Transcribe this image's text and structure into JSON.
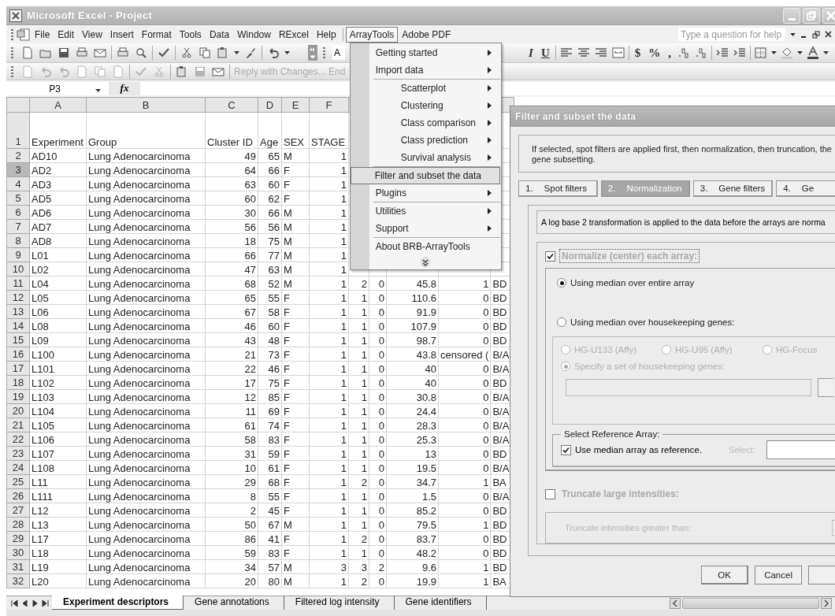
{
  "window": {
    "title": "Microsoft Excel - Project"
  },
  "menu_bar": {
    "items": [
      {
        "label": "File",
        "selected": false
      },
      {
        "label": "Edit",
        "selected": false
      },
      {
        "label": "View",
        "selected": false
      },
      {
        "label": "Insert",
        "selected": false
      },
      {
        "label": "Format",
        "selected": false
      },
      {
        "label": "Tools",
        "selected": false
      },
      {
        "label": "Data",
        "selected": false
      },
      {
        "label": "Window",
        "selected": false
      },
      {
        "label": "RExcel",
        "selected": false
      },
      {
        "label": "Help",
        "selected": false
      },
      {
        "label": "ArrayTools",
        "selected": true
      },
      {
        "label": "Adobe PDF",
        "selected": false
      }
    ],
    "help_box": {
      "placeholder": "Type a question for help"
    }
  },
  "dropdown": {
    "items": [
      {
        "label": "Getting started",
        "submenu": true,
        "indent": false,
        "group_start": false,
        "selected": false
      },
      {
        "label": "Import data",
        "submenu": true,
        "indent": false,
        "group_start": false,
        "selected": false
      },
      {
        "label": "Scatterplot",
        "submenu": true,
        "indent": true,
        "group_start": true,
        "selected": false
      },
      {
        "label": "Clustering",
        "submenu": true,
        "indent": true,
        "group_start": false,
        "selected": false
      },
      {
        "label": "Class comparison",
        "submenu": true,
        "indent": true,
        "group_start": false,
        "selected": false
      },
      {
        "label": "Class prediction",
        "submenu": true,
        "indent": true,
        "group_start": false,
        "selected": false
      },
      {
        "label": "Survival analysis",
        "submenu": true,
        "indent": true,
        "group_start": false,
        "selected": false
      },
      {
        "label": "Filter and subset the data",
        "submenu": false,
        "indent": false,
        "group_start": true,
        "selected": true
      },
      {
        "label": "Plugins",
        "submenu": true,
        "indent": false,
        "group_start": false,
        "selected": false
      },
      {
        "label": "Utilities",
        "submenu": true,
        "indent": false,
        "group_start": true,
        "selected": false
      },
      {
        "label": "Support",
        "submenu": true,
        "indent": false,
        "group_start": false,
        "selected": false
      },
      {
        "label": "About BRB-ArrayTools",
        "submenu": false,
        "indent": false,
        "group_start": true,
        "selected": false
      }
    ]
  },
  "standard_toolbar": {
    "font_box": "A"
  },
  "formatting_toolbar": {
    "buttons": [
      {
        "label": "I",
        "kind": "italic"
      },
      {
        "label": "U",
        "kind": "underline"
      },
      {
        "label": "$",
        "kind": "plain"
      },
      {
        "label": "%",
        "kind": "plain"
      },
      {
        "label": ",",
        "kind": "plain"
      }
    ]
  },
  "reviewing_toolbar": {
    "reply_text": "Reply with Changes... End"
  },
  "formula_bar": {
    "name_box": "P3",
    "fx": "fx"
  },
  "sheet": {
    "columns": [
      "A",
      "B",
      "C",
      "D",
      "E",
      "F"
    ],
    "rows": [
      {
        "number": "1",
        "selected": false,
        "cells": [
          "Experiment",
          "Group",
          "Cluster ID",
          "Age",
          "SEX",
          "STAGE"
        ]
      },
      {
        "number": "2",
        "selected": false,
        "cells": [
          "AD10",
          "Lung Adenocarcinoma",
          "49",
          "65",
          "M",
          "1"
        ]
      },
      {
        "number": "3",
        "selected": true,
        "cells": [
          "AD2",
          "Lung Adenocarcinoma",
          "64",
          "66",
          "F",
          "1"
        ]
      },
      {
        "number": "4",
        "selected": false,
        "cells": [
          "AD3",
          "Lung Adenocarcinoma",
          "63",
          "60",
          "F",
          "1"
        ]
      },
      {
        "number": "5",
        "selected": false,
        "cells": [
          "AD5",
          "Lung Adenocarcinoma",
          "60",
          "62",
          "F",
          "1"
        ]
      },
      {
        "number": "6",
        "selected": false,
        "cells": [
          "AD6",
          "Lung Adenocarcinoma",
          "30",
          "66",
          "M",
          "1"
        ]
      },
      {
        "number": "7",
        "selected": false,
        "cells": [
          "AD7",
          "Lung Adenocarcinoma",
          "56",
          "56",
          "M",
          "1"
        ]
      },
      {
        "number": "8",
        "selected": false,
        "cells": [
          "AD8",
          "Lung Adenocarcinoma",
          "18",
          "75",
          "M",
          "1"
        ]
      },
      {
        "number": "9",
        "selected": false,
        "cells": [
          "L01",
          "Lung Adenocarcinoma",
          "66",
          "77",
          "M",
          "1"
        ]
      },
      {
        "number": "10",
        "selected": false,
        "cells": [
          "L02",
          "Lung Adenocarcinoma",
          "47",
          "63",
          "M",
          "1"
        ]
      },
      {
        "number": "11",
        "selected": false,
        "cells": [
          "L04",
          "Lung Adenocarcinoma",
          "68",
          "52",
          "M",
          "1",
          "2",
          "0",
          "45.8",
          "1",
          "BD"
        ]
      },
      {
        "number": "12",
        "selected": false,
        "cells": [
          "L05",
          "Lung Adenocarcinoma",
          "65",
          "55",
          "F",
          "1",
          "1",
          "0",
          "110.6",
          "0",
          "BD"
        ]
      },
      {
        "number": "13",
        "selected": false,
        "cells": [
          "L06",
          "Lung Adenocarcinoma",
          "67",
          "58",
          "F",
          "1",
          "1",
          "0",
          "91.9",
          "0",
          "BD"
        ]
      },
      {
        "number": "14",
        "selected": false,
        "cells": [
          "L08",
          "Lung Adenocarcinoma",
          "46",
          "60",
          "F",
          "1",
          "1",
          "0",
          "107.9",
          "0",
          "BD"
        ]
      },
      {
        "number": "15",
        "selected": false,
        "cells": [
          "L09",
          "Lung Adenocarcinoma",
          "43",
          "48",
          "F",
          "1",
          "1",
          "0",
          "98.7",
          "0",
          "BD"
        ]
      },
      {
        "number": "16",
        "selected": false,
        "cells": [
          "L100",
          "Lung Adenocarcinoma",
          "21",
          "73",
          "F",
          "1",
          "1",
          "0",
          "43.8",
          "censored (",
          "B/A"
        ]
      },
      {
        "number": "17",
        "selected": false,
        "cells": [
          "L101",
          "Lung Adenocarcinoma",
          "22",
          "46",
          "F",
          "1",
          "1",
          "0",
          "40",
          "0",
          "B/A"
        ]
      },
      {
        "number": "18",
        "selected": false,
        "cells": [
          "L102",
          "Lung Adenocarcinoma",
          "17",
          "75",
          "F",
          "1",
          "1",
          "0",
          "40",
          "0",
          "BD"
        ]
      },
      {
        "number": "19",
        "selected": false,
        "cells": [
          "L103",
          "Lung Adenocarcinoma",
          "12",
          "85",
          "F",
          "1",
          "1",
          "0",
          "30.8",
          "0",
          "B/A"
        ]
      },
      {
        "number": "20",
        "selected": false,
        "cells": [
          "L104",
          "Lung Adenocarcinoma",
          "11",
          "69",
          "F",
          "1",
          "1",
          "0",
          "24.4",
          "0",
          "B/A"
        ]
      },
      {
        "number": "21",
        "selected": false,
        "cells": [
          "L105",
          "Lung Adenocarcinoma",
          "61",
          "74",
          "F",
          "1",
          "1",
          "0",
          "28.3",
          "0",
          "B/A"
        ]
      },
      {
        "number": "22",
        "selected": false,
        "cells": [
          "L106",
          "Lung Adenocarcinoma",
          "58",
          "83",
          "F",
          "1",
          "1",
          "0",
          "25.3",
          "0",
          "B/A"
        ]
      },
      {
        "number": "23",
        "selected": false,
        "cells": [
          "L107",
          "Lung Adenocarcinoma",
          "31",
          "59",
          "F",
          "1",
          "1",
          "0",
          "13",
          "0",
          "BD"
        ]
      },
      {
        "number": "24",
        "selected": false,
        "cells": [
          "L108",
          "Lung Adenocarcinoma",
          "10",
          "61",
          "F",
          "1",
          "1",
          "0",
          "19.5",
          "0",
          "B/A"
        ]
      },
      {
        "number": "25",
        "selected": false,
        "cells": [
          "L11",
          "Lung Adenocarcinoma",
          "29",
          "68",
          "F",
          "1",
          "2",
          "0",
          "34.7",
          "1",
          "BA"
        ]
      },
      {
        "number": "26",
        "selected": false,
        "cells": [
          "L111",
          "Lung Adenocarcinoma",
          "8",
          "55",
          "F",
          "1",
          "1",
          "0",
          "1.5",
          "0",
          "B/A"
        ]
      },
      {
        "number": "27",
        "selected": false,
        "cells": [
          "L12",
          "Lung Adenocarcinoma",
          "2",
          "45",
          "F",
          "1",
          "1",
          "0",
          "85.2",
          "0",
          "BD"
        ]
      },
      {
        "number": "28",
        "selected": false,
        "cells": [
          "L13",
          "Lung Adenocarcinoma",
          "50",
          "67",
          "M",
          "1",
          "1",
          "0",
          "79.5",
          "1",
          "BD"
        ]
      },
      {
        "number": "29",
        "selected": false,
        "cells": [
          "L17",
          "Lung Adenocarcinoma",
          "86",
          "41",
          "F",
          "1",
          "2",
          "0",
          "83.7",
          "0",
          "BD"
        ]
      },
      {
        "number": "30",
        "selected": false,
        "cells": [
          "L18",
          "Lung Adenocarcinoma",
          "59",
          "83",
          "F",
          "1",
          "1",
          "0",
          "48.2",
          "0",
          "BD"
        ]
      },
      {
        "number": "31",
        "selected": false,
        "cells": [
          "L19",
          "Lung Adenocarcinoma",
          "34",
          "57",
          "M",
          "3",
          "3",
          "2",
          "9.6",
          "1",
          "BD"
        ]
      },
      {
        "number": "32",
        "selected": false,
        "cells": [
          "L20",
          "Lung Adenocarcinoma",
          "20",
          "80",
          "M",
          "1",
          "2",
          "0",
          "19.9",
          "1",
          "BA"
        ]
      }
    ]
  },
  "sheet_tabs": [
    {
      "label": "Experiment descriptors",
      "selected": true
    },
    {
      "label": "Gene annotations",
      "selected": false
    },
    {
      "label": "Filtered log intensity",
      "selected": false
    },
    {
      "label": "Gene identifiers",
      "selected": false
    }
  ],
  "dialog": {
    "title": "Filter and subset the data",
    "info_lines": [
      "If selected, spot filters are applied first, then normalization, then truncation, the",
      "gene subsetting."
    ],
    "tabs": [
      {
        "number": "1.",
        "label": "Spot filters",
        "selected": false
      },
      {
        "number": "2.",
        "label": "Normalization",
        "selected": true
      },
      {
        "number": "3.",
        "label": "Gene filters",
        "selected": false
      },
      {
        "number": "4.",
        "label": "Ge",
        "selected": false
      }
    ],
    "description": "A log base 2 transformation is applied to the data before the arrays are norma",
    "normalize": {
      "label": "Normalize (center) each array:",
      "checked": true
    },
    "methods": [
      {
        "label": "Using median over entire array",
        "selected": true
      },
      {
        "label": "Using median over housekeeping genes:",
        "selected": false
      }
    ],
    "housekeeping_options": [
      {
        "label": "HG-U133 (Affy)",
        "selected": false
      },
      {
        "label": "HG-U95 (Affy)",
        "selected": false
      },
      {
        "label": "HG-Focus",
        "selected": false
      }
    ],
    "specify": {
      "label": "Specify a set of housekeeping genes:",
      "selected": true
    },
    "reference": {
      "legend": "Select Reference Array:",
      "checkbox_label": "Use median array as reference.",
      "checked": true,
      "select_label": "Select:"
    },
    "truncate": {
      "label": "Truncate large intensities:",
      "checked": false,
      "field_label": "Truncate intensities greater than:"
    },
    "buttons": [
      "OK",
      "Cancel"
    ]
  }
}
